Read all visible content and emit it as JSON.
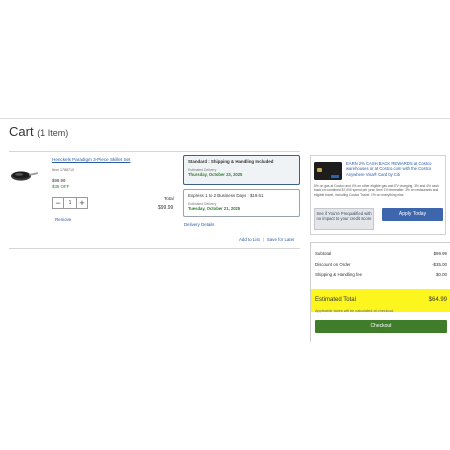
{
  "cart": {
    "title": "Cart",
    "count_label": "(1 Item)"
  },
  "product": {
    "name": "Henckels Paradigm 3-Piece Skillet Set",
    "item_number": "Item 1788710",
    "price": "$99.99",
    "discount": "$35 OFF",
    "quantity": "1",
    "remove_label": "Remove",
    "total_label": "Total",
    "total_value": "$99.99"
  },
  "shipping": {
    "selected": {
      "title": "Standard : Shipping & Handling Included",
      "sub": "Estimated Delivery",
      "date": "Thursday, October 23, 2025"
    },
    "alt": {
      "title": "Express 1 to 2 Business Days : $19.61",
      "sub": "Estimated Delivery",
      "date": "Tuesday, October 21, 2025"
    },
    "delivery_link": "Delivery Details"
  },
  "links": {
    "add_to_list": "Add to List",
    "save_for_later": "Save for Later"
  },
  "promo": {
    "headline": "EARN 2% CASH BACK REWARDS at Costco warehouses or at Costco.com with the Costco Anywhere Visa® Card by Citi",
    "body": "5% on gas at Costco and 4% on other eligible gas and EV charging, 3% and 4% cash back on combined $7,000 spend per year, then 1% thereafter. 3% on restaurants and eligible travel, including Costco Travel. 1% on everything else.",
    "prequal_label": "See if You're Prequalified with no impact to your credit score",
    "apply_label": "Apply Today"
  },
  "summary": {
    "subtotal_label": "Subtotal",
    "subtotal_value": "$99.99",
    "discount_label": "Discount on Order",
    "discount_value": "-$35.00",
    "shipping_label": "Shipping & Handling fee",
    "shipping_value": "$0.00",
    "estimated_label": "Estimated Total",
    "estimated_value": "$64.99",
    "tax_note": "Applicable taxes will be calculated at checkout.",
    "checkout_label": "Checkout"
  },
  "icons": {
    "minus": "minus-icon",
    "plus": "plus-icon",
    "product": "skillet-image",
    "card": "credit-card-image"
  },
  "colors": {
    "link": "#2a5aa8",
    "green": "#2f7d2f",
    "highlight": "#fcf51e",
    "apply_button": "#3d66ad",
    "checkout_button": "#3f7d2a"
  }
}
